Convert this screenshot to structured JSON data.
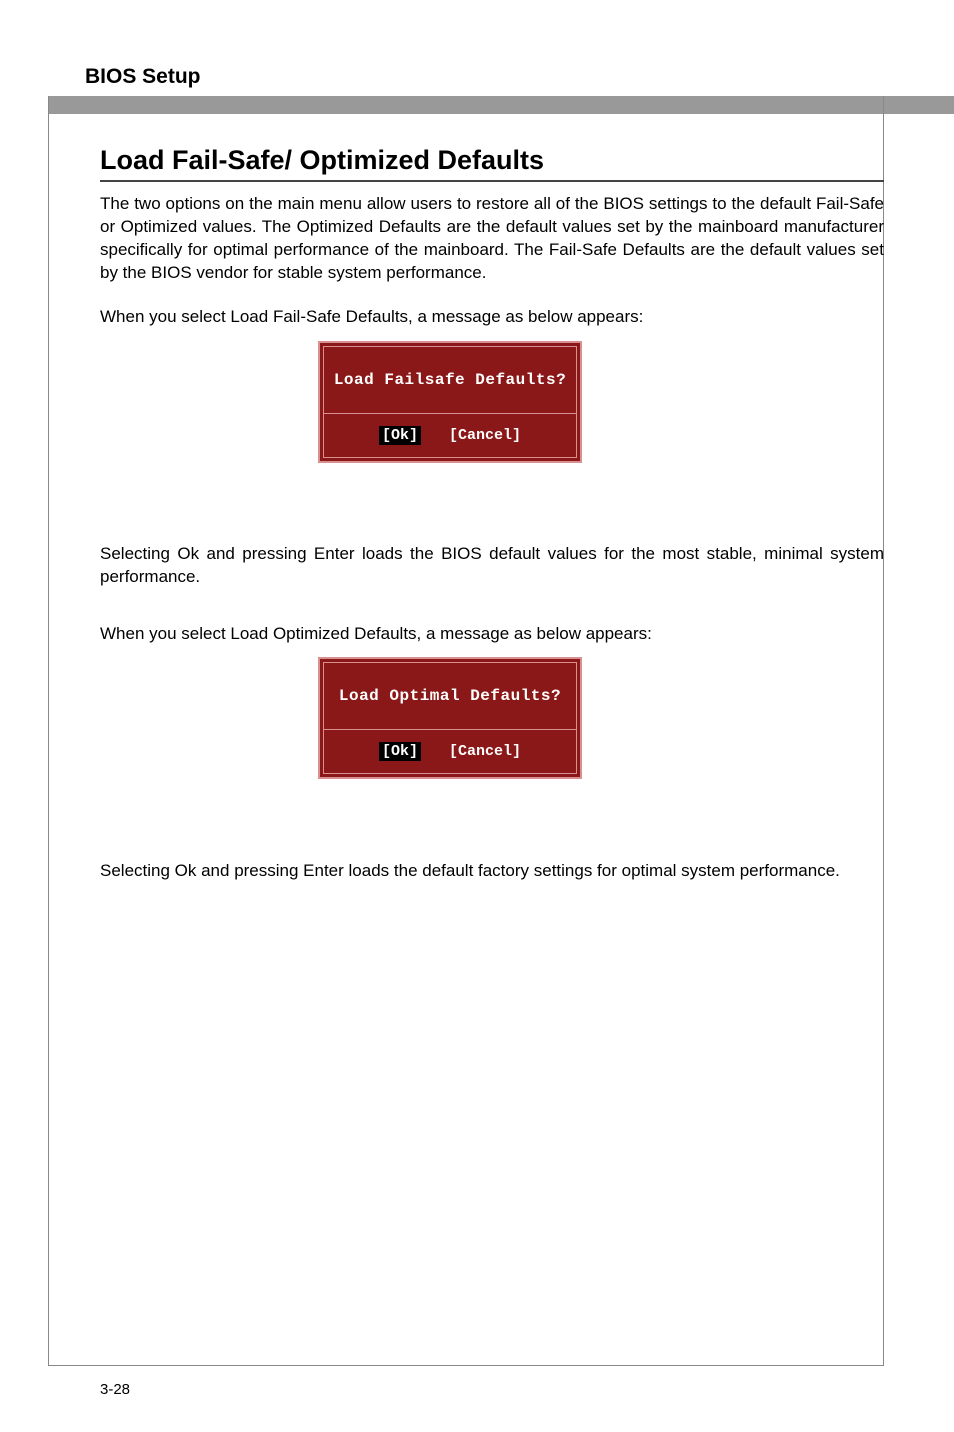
{
  "header": {
    "title": "BIOS Setup"
  },
  "section": {
    "title": "Load Fail-Safe/ Optimized Defaults"
  },
  "paragraphs": {
    "intro": "The two options on the main menu allow users to restore all of the BIOS settings to the default Fail-Safe or Optimized values. The Optimized Defaults are the default values set by the mainboard manufacturer specifically for optimal performance of the mainboard. The Fail-Safe Defaults are the default values set by the BIOS vendor for stable system performance.",
    "failsafe_prompt": "When you select Load Fail-Safe Defaults, a message as below appears:",
    "failsafe_result": "Selecting Ok and pressing Enter loads the BIOS default values for the most stable, minimal system performance.",
    "optimized_prompt": "When you select Load Optimized Defaults, a message as below appears:",
    "optimized_result": "Selecting Ok and pressing Enter loads the default factory settings for optimal system performance."
  },
  "dialog_failsafe": {
    "question": "Load Failsafe Defaults?",
    "ok": "[Ok]",
    "cancel": "[Cancel]"
  },
  "dialog_optimal": {
    "question": "Load Optimal Defaults?",
    "ok": "[Ok]",
    "cancel": "[Cancel]"
  },
  "footer": {
    "page_number": "3-28"
  }
}
